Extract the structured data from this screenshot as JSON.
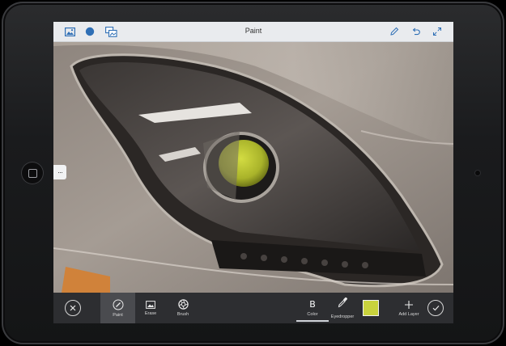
{
  "app": {
    "title": "Paint"
  },
  "topbar": {
    "left_icons": [
      "image-icon",
      "circle-icon",
      "layers-icon"
    ],
    "right_icons": [
      "pencil-icon",
      "undo-icon",
      "expand-icon"
    ]
  },
  "canvas": {
    "side_handle": "···",
    "paint_color": "#c8d630"
  },
  "toolbar": {
    "cancel_icon": "close-circle-icon",
    "confirm_icon": "check-circle-icon",
    "tools": [
      {
        "label": "Paint",
        "icon": "paint-brush-icon",
        "active": true
      },
      {
        "label": "Erase",
        "icon": "eraser-icon",
        "active": false
      },
      {
        "label": "Brush",
        "icon": "aperture-icon",
        "active": false
      }
    ],
    "color_tool": {
      "letter": "B",
      "label": "Color"
    },
    "eyedropper_label": "Eyedropper",
    "swatch_color": "#c9d33d",
    "add_layer_label": "Add Layer"
  }
}
